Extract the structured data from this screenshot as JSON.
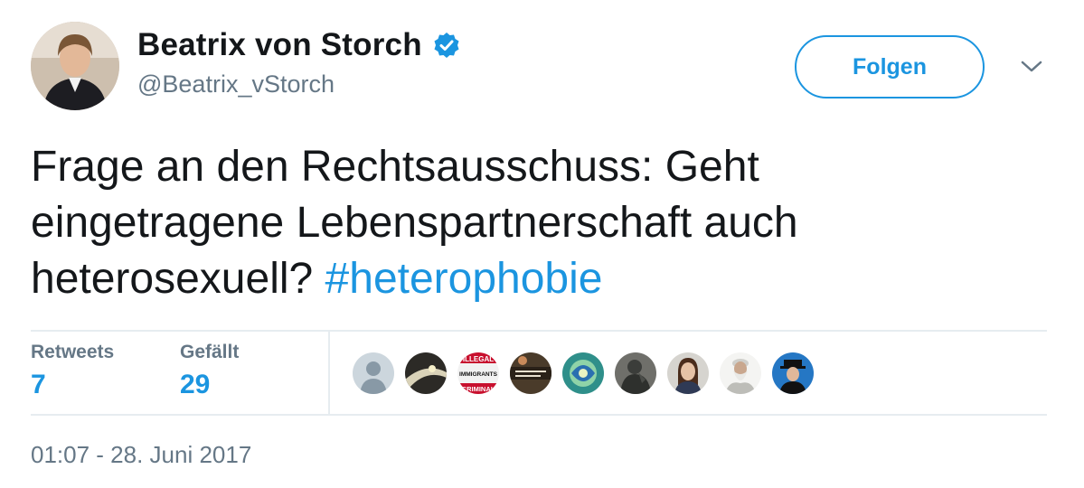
{
  "tweet": {
    "author": {
      "display_name": "Beatrix von Storch",
      "handle": "@Beatrix_vStorch",
      "verified": true,
      "verified_icon": "verified-badge-icon"
    },
    "follow_label": "Folgen",
    "menu_icon": "chevron-down-icon",
    "text": {
      "line1": "Frage an den Rechtsausschuss: Geht",
      "line2": "eingetragene Lebenspartnerschaft auch",
      "line3_prefix": "heterosexuell? ",
      "hashtag": "#heterophobie"
    },
    "stats": {
      "retweets_label": "Retweets",
      "retweets_value": "7",
      "likes_label": "Gefällt",
      "likes_value": "29"
    },
    "liker_avatars": [
      "default-user-avatar",
      "tunnel-avatar",
      "illegal-immigrants-sign-avatar",
      "text-poster-avatar",
      "abstract-avatar",
      "statue-avatar",
      "woman-portrait-avatar",
      "bearded-man-avatar",
      "man-with-hat-avatar"
    ],
    "liker_avatar_3_text": "ILLEGAL IMMIGRANTS CRIMINAL",
    "timestamp": "01:07 - 28. Juni 2017",
    "colors": {
      "accent": "#1b95e0",
      "muted": "#657786",
      "text": "#14171a",
      "divider": "#e6ecf0"
    }
  }
}
